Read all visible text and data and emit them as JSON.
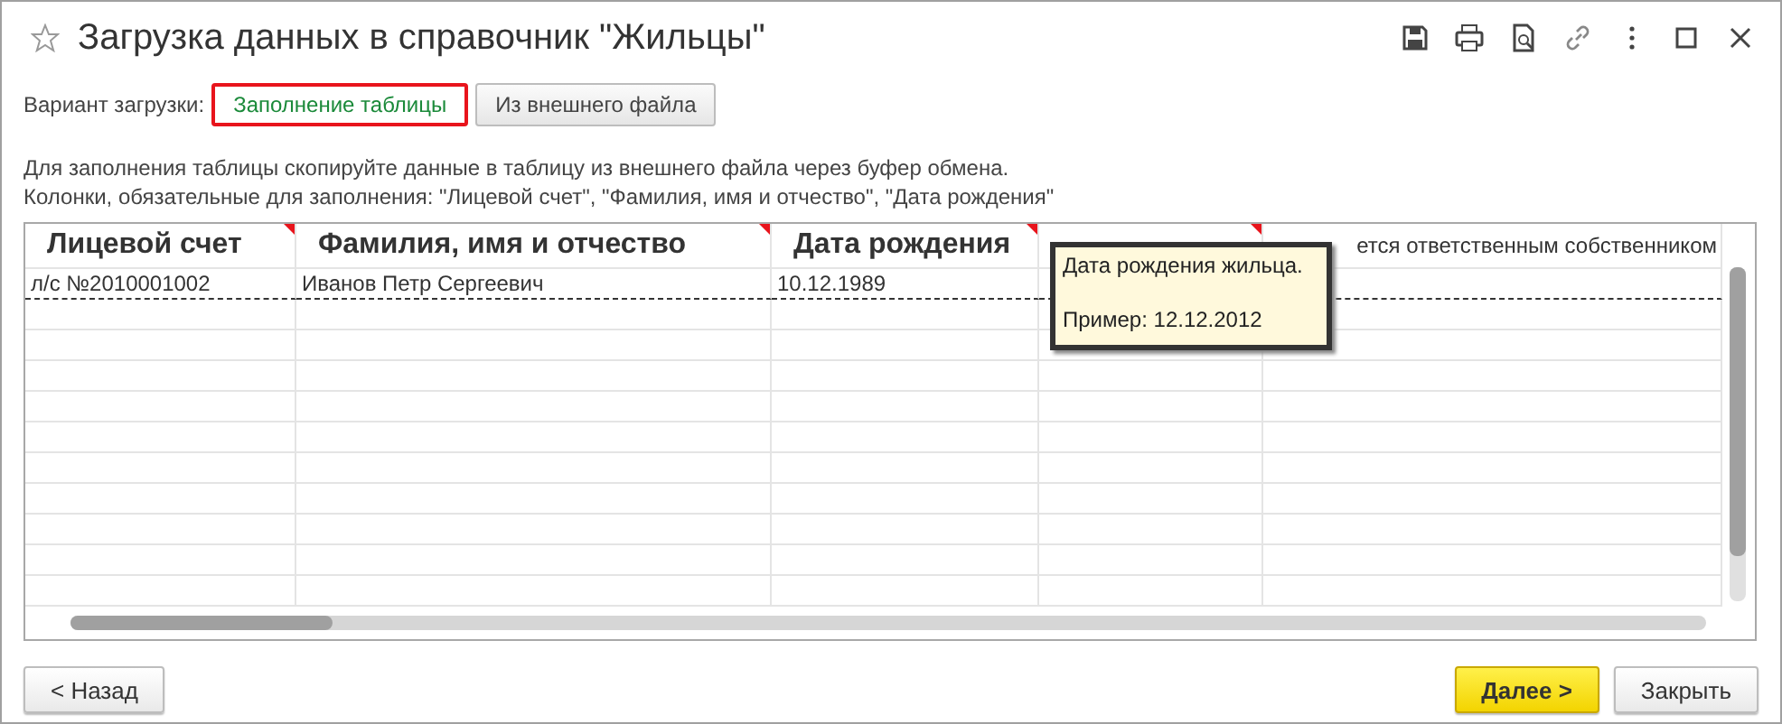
{
  "window": {
    "title": "Загрузка данных в справочник \"Жильцы\"",
    "favorite": false
  },
  "load_variant": {
    "label": "Вариант загрузки:",
    "options": [
      {
        "label": "Заполнение таблицы",
        "selected": true
      },
      {
        "label": "Из внешнего файла",
        "selected": false
      }
    ]
  },
  "hint_lines": [
    "Для заполнения таблицы скопируйте данные в таблицу из внешнего файла через буфер обмена.",
    "Колонки, обязательные для заполнения: \"Лицевой счет\", \"Фамилия, имя и отчество\", \"Дата рождения\""
  ],
  "table": {
    "columns": [
      {
        "label": "Лицевой счет",
        "marked": true,
        "bold": true
      },
      {
        "label": "Фамилия, имя и отчество",
        "marked": true,
        "bold": true
      },
      {
        "label": "Дата рождения",
        "marked": true,
        "bold": true
      },
      {
        "marked": true,
        "bold": true
      },
      {
        "label": "ется ответственным собственником",
        "marked": false,
        "bold": false
      }
    ],
    "rows": [
      {
        "cells": [
          "л/с №2010001002",
          "Иванов Петр Сергеевич",
          "10.12.1989",
          "",
          ""
        ],
        "current": true
      }
    ]
  },
  "tooltip": {
    "lines": [
      "Дата рождения жильца.",
      "Пример: 12.12.2012"
    ]
  },
  "buttons": {
    "back": "< Назад",
    "next": "Далее >",
    "close": "Закрыть"
  }
}
